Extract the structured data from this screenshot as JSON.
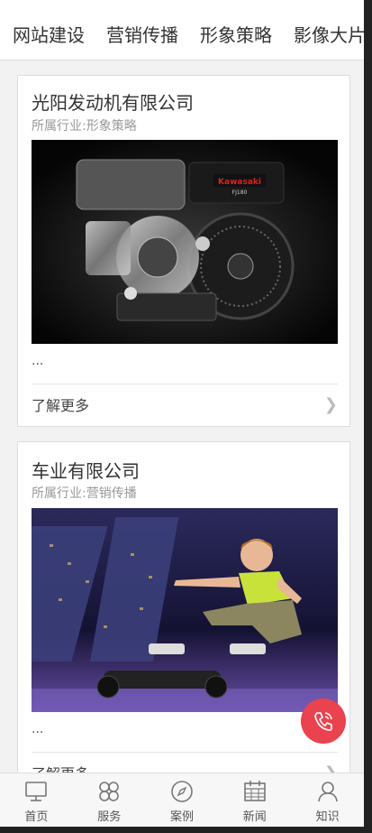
{
  "tabs": [
    {
      "label": "网站建设"
    },
    {
      "label": "营销传播"
    },
    {
      "label": "形象策略"
    },
    {
      "label": "影像大片"
    }
  ],
  "cards": [
    {
      "title": "光阳发动机有限公司",
      "subtitle": "所属行业:形象策略",
      "image_icon": "engine-photo",
      "image_brand": "Kawasaki",
      "image_model": "FJ180",
      "excerpt": "...",
      "more_label": "了解更多"
    },
    {
      "title": "车业有限公司",
      "subtitle": "所属行业:营销传播",
      "image_icon": "hoverboard-photo",
      "excerpt": "...",
      "more_label": "了解更多"
    }
  ],
  "fab": {
    "icon": "phone-icon",
    "color": "#e8434e"
  },
  "bottom_nav": [
    {
      "label": "首页",
      "icon": "monitor-icon"
    },
    {
      "label": "服务",
      "icon": "clover-icon"
    },
    {
      "label": "案例",
      "icon": "compass-icon"
    },
    {
      "label": "新闻",
      "icon": "calendar-icon"
    },
    {
      "label": "知识",
      "icon": "person-icon"
    }
  ]
}
